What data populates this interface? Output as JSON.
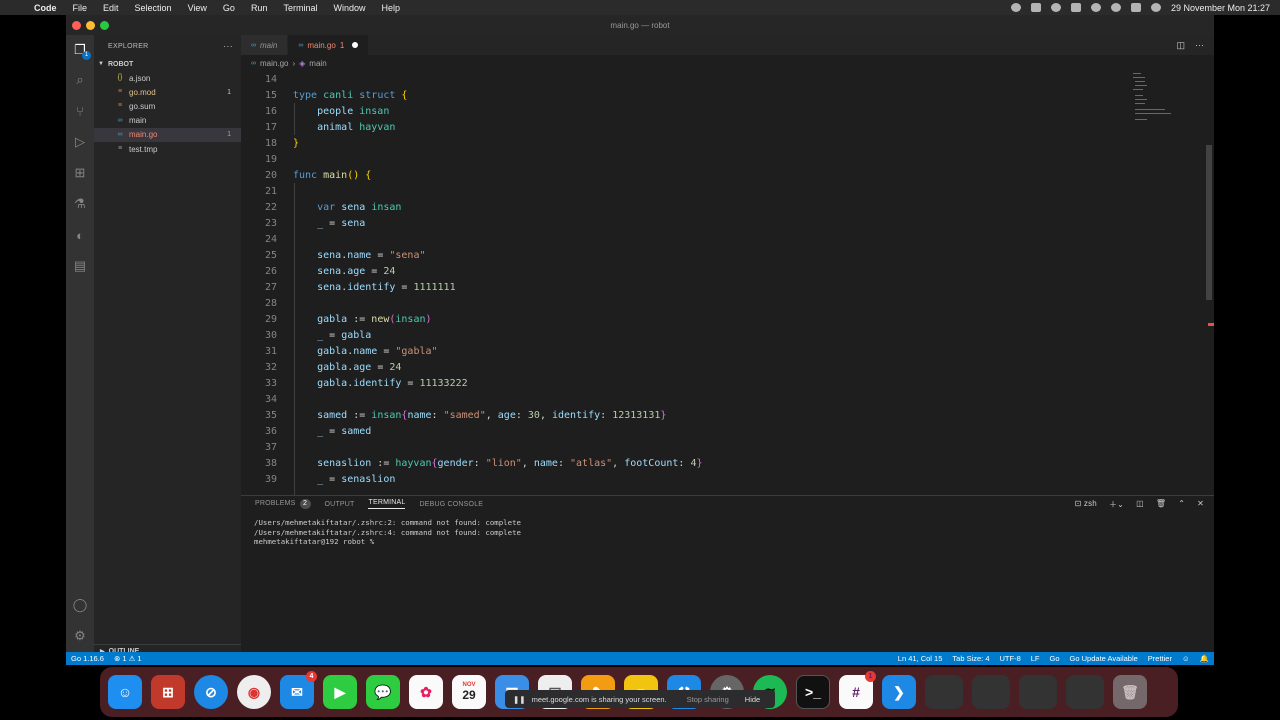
{
  "menubar": {
    "app_name": "Code",
    "items": [
      "File",
      "Edit",
      "Selection",
      "View",
      "Go",
      "Run",
      "Terminal",
      "Window",
      "Help"
    ],
    "datetime": "29 November Mon 21:27"
  },
  "window_title": "main.go — robot",
  "explorer": {
    "header": "EXPLORER",
    "more": "···",
    "folder": "ROBOT",
    "files": [
      {
        "name": "a.json",
        "icon": "{}",
        "badge": ""
      },
      {
        "name": "go.mod",
        "icon": "≡",
        "badge": "1"
      },
      {
        "name": "go.sum",
        "icon": "≡",
        "badge": ""
      },
      {
        "name": "main",
        "icon": "∞",
        "badge": ""
      },
      {
        "name": "main.go",
        "icon": "∞",
        "badge": "1"
      },
      {
        "name": "test.tmp",
        "icon": "≡",
        "badge": ""
      }
    ],
    "outline": "OUTLINE"
  },
  "tabs": [
    {
      "label": "main"
    },
    {
      "label": "main.go",
      "count": "1"
    }
  ],
  "breadcrumb": [
    "main.go",
    "main"
  ],
  "code": {
    "lines": [
      {
        "n": "14",
        "t": ""
      },
      {
        "n": "15",
        "t": "type canli struct {"
      },
      {
        "n": "16",
        "t": "    people insan"
      },
      {
        "n": "17",
        "t": "    animal hayvan"
      },
      {
        "n": "18",
        "t": "}"
      },
      {
        "n": "19",
        "t": ""
      },
      {
        "n": "20",
        "t": "func main() {"
      },
      {
        "n": "21",
        "t": ""
      },
      {
        "n": "22",
        "t": "    var sena insan"
      },
      {
        "n": "23",
        "t": "    _ = sena"
      },
      {
        "n": "24",
        "t": ""
      },
      {
        "n": "25",
        "t": "    sena.name = \"sena\""
      },
      {
        "n": "26",
        "t": "    sena.age = 24"
      },
      {
        "n": "27",
        "t": "    sena.identify = 1111111"
      },
      {
        "n": "28",
        "t": ""
      },
      {
        "n": "29",
        "t": "    gabla := new(insan)"
      },
      {
        "n": "30",
        "t": "    _ = gabla"
      },
      {
        "n": "31",
        "t": "    gabla.name = \"gabla\""
      },
      {
        "n": "32",
        "t": "    gabla.age = 24"
      },
      {
        "n": "33",
        "t": "    gabla.identify = 11133222"
      },
      {
        "n": "34",
        "t": ""
      },
      {
        "n": "35",
        "t": "    samed := insan{name: \"samed\", age: 30, identify: 12313131}"
      },
      {
        "n": "36",
        "t": "    _ = samed"
      },
      {
        "n": "37",
        "t": ""
      },
      {
        "n": "38",
        "t": "    senaslion := hayvan{gender: \"lion\", name: \"atlas\", footCount: 4}"
      },
      {
        "n": "39",
        "t": "    _ = senaslion"
      }
    ]
  },
  "panel": {
    "tabs": [
      "PROBLEMS",
      "OUTPUT",
      "TERMINAL",
      "DEBUG CONSOLE"
    ],
    "problems_count": "2",
    "active": "TERMINAL",
    "shell": "zsh",
    "terminal_lines": [
      "/Users/mehmetakiftatar/.zshrc:2: command not found: complete",
      "/Users/mehmetakiftatar/.zshrc:4: command not found: complete",
      "mehmetakiftatar@192 robot % "
    ]
  },
  "statusbar": {
    "go_version": "Go 1.16.6",
    "problems": "⊗ 1 ⚠ 1",
    "position": "Ln 41, Col 15",
    "tab_size": "Tab Size: 4",
    "encoding": "UTF-8",
    "eol": "LF",
    "language": "Go",
    "update": "Go Update Available",
    "formatter": "Prettier"
  },
  "dock": {
    "calendar_month": "NOV",
    "calendar_day": "29",
    "mail_badge": "4",
    "slack_badge": "1"
  },
  "share_banner": {
    "text": "meet.google.com is sharing your screen.",
    "stop": "Stop sharing",
    "hide": "Hide"
  },
  "colors": {
    "statusbar": "#007acc",
    "editor_bg": "#1e1e1e",
    "sidebar_bg": "#252526",
    "activity_bg": "#333333",
    "dock_bg": "#4a1f23"
  }
}
